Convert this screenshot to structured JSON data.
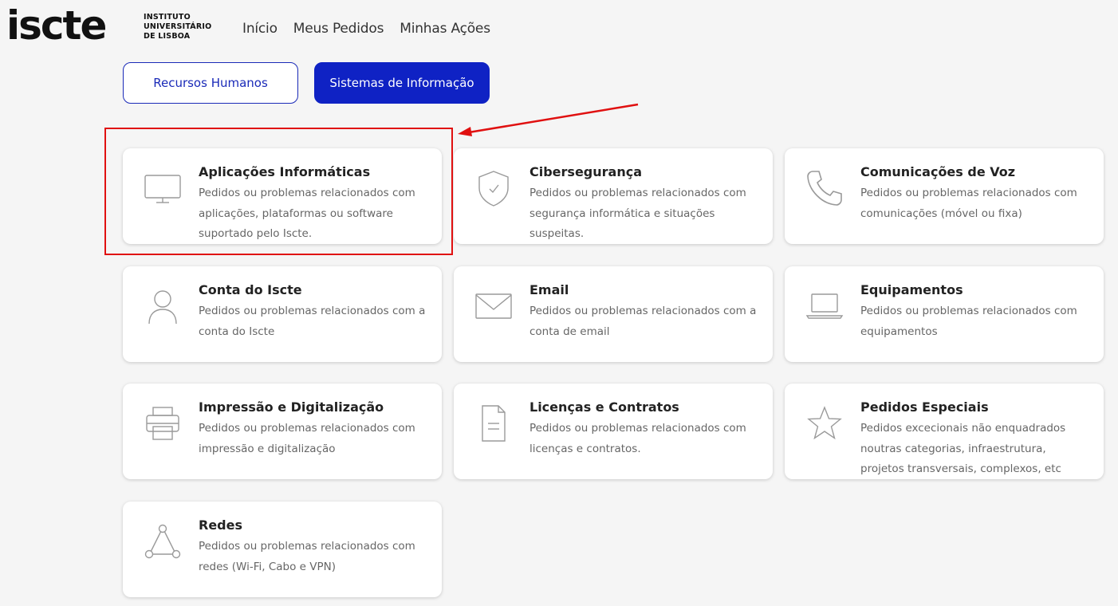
{
  "header": {
    "logo_text": "iscte",
    "logo_sub": [
      "INSTITUTO",
      "UNIVERSITÁRIO",
      "DE LISBOA"
    ],
    "nav": [
      {
        "label": "Início"
      },
      {
        "label": "Meus Pedidos"
      },
      {
        "label": "Minhas Ações"
      }
    ]
  },
  "tabs": [
    {
      "label": "Recursos Humanos",
      "active": false
    },
    {
      "label": "Sistemas de Informação",
      "active": true
    }
  ],
  "cards": [
    {
      "icon": "monitor-icon",
      "title": "Aplicações Informáticas",
      "desc": "Pedidos ou problemas relacionados com aplicações, plataformas ou software suportado pelo Iscte."
    },
    {
      "icon": "shield-icon",
      "title": "Cibersegurança",
      "desc": "Pedidos ou problemas relacionados com segurança informática e situações suspeitas."
    },
    {
      "icon": "phone-icon",
      "title": "Comunicações de Voz",
      "desc": "Pedidos ou problemas relacionados com comunicações (móvel ou fixa)"
    },
    {
      "icon": "user-icon",
      "title": "Conta do Iscte",
      "desc": "Pedidos ou problemas relacionados com a conta do Iscte"
    },
    {
      "icon": "envelope-icon",
      "title": "Email",
      "desc": "Pedidos ou problemas relacionados com a conta de email"
    },
    {
      "icon": "laptop-icon",
      "title": "Equipamentos",
      "desc": "Pedidos ou problemas relacionados com equipamentos"
    },
    {
      "icon": "printer-icon",
      "title": "Impressão e Digitalização",
      "desc": "Pedidos ou problemas relacionados com impressão e digitalização"
    },
    {
      "icon": "document-icon",
      "title": "Licenças e Contratos",
      "desc": "Pedidos ou problemas relacionados com licenças e contratos."
    },
    {
      "icon": "star-icon",
      "title": "Pedidos Especiais",
      "desc": "Pedidos excecionais não enquadrados noutras categorias, infraestrutura, projetos transversais, complexos, etc"
    },
    {
      "icon": "network-icon",
      "title": "Redes",
      "desc": "Pedidos ou problemas relacionados com redes (Wi-Fi, Cabo e VPN)"
    }
  ],
  "colors": {
    "accent": "#0f22c4",
    "highlight": "#e01010",
    "icon_stroke": "#9a9a9a"
  }
}
